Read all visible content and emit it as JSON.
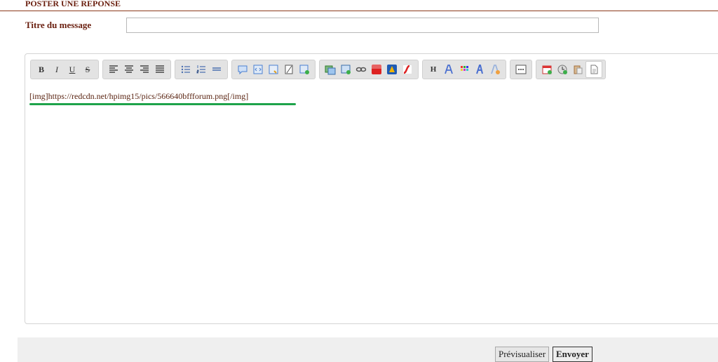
{
  "section": {
    "title": "POSTER UNE REPONSE"
  },
  "form": {
    "title_label": "Titre du message",
    "title_value": ""
  },
  "toolbar": {
    "groups": [
      [
        "bold-icon",
        "italic-icon",
        "underline-icon",
        "strikethrough-icon"
      ],
      [
        "align-left-icon",
        "align-center-icon",
        "align-right-icon",
        "justify-icon"
      ],
      [
        "bullet-list-icon",
        "numbered-list-icon",
        "horizontal-rule-icon"
      ],
      [
        "quote-icon",
        "code-icon",
        "spoiler-icon",
        "hide-icon",
        "table-icon"
      ],
      [
        "image-host-icon",
        "image-icon",
        "link-icon",
        "youtube-icon",
        "dailymotion-icon",
        "flash-icon"
      ],
      [
        "heading-icon",
        "font-icon",
        "color-icon",
        "text-style-icon",
        "remove-format-icon"
      ],
      [
        "more-icon"
      ],
      [
        "date-icon",
        "clock-icon",
        "paste-icon",
        "document-icon"
      ]
    ],
    "labels": {
      "bold": "B",
      "italic": "I",
      "underline": "U",
      "strike": "S",
      "heading": "H"
    }
  },
  "editor": {
    "content": "[img]https://redcdn.net/hpimg15/pics/566640bffforum.png[/img]"
  },
  "buttons": {
    "preview": "Prévisualiser",
    "send": "Envoyer"
  },
  "colors": {
    "accent": "#6a1f0f",
    "underline_mark": "#1ea34a"
  }
}
